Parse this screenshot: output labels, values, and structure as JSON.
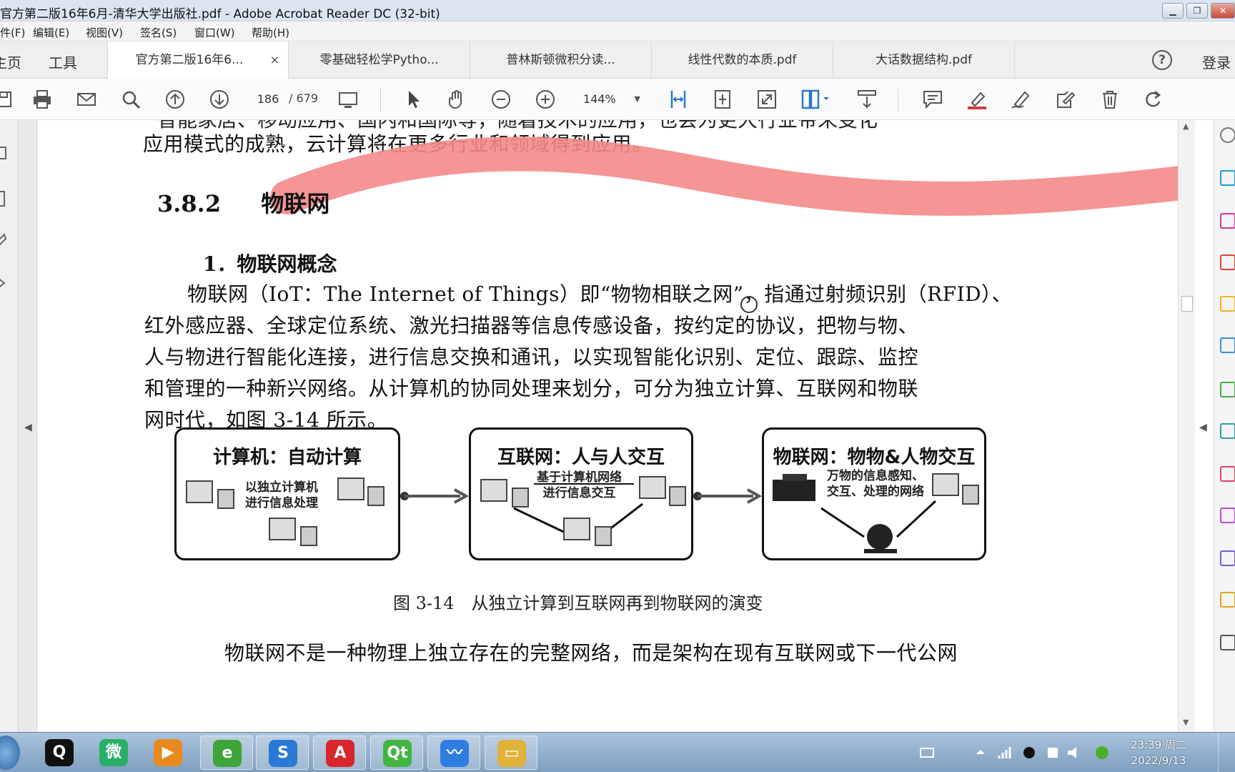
{
  "window": {
    "title": "官方第二版16年6月-清华大学出版社.pdf - Adobe Acrobat Reader DC (32-bit)"
  },
  "menu": [
    "件(F)",
    "编辑(E)",
    "视图(V)",
    "签名(S)",
    "窗口(W)",
    "帮助(H)"
  ],
  "nav": {
    "home": "主页",
    "tools": "工具",
    "login": "登录",
    "help_symbol": "?"
  },
  "tabs": [
    {
      "label": "官方第二版16年6...",
      "active": true,
      "close": "×"
    },
    {
      "label": "零基础轻松学Pytho...",
      "active": false
    },
    {
      "label": "普林斯顿微积分读...",
      "active": false
    },
    {
      "label": "线性代数的本质.pdf",
      "active": false
    },
    {
      "label": "大话数据结构.pdf",
      "active": false
    }
  ],
  "toolbar": {
    "page_current": "186",
    "page_total": "/ 679",
    "zoom": "144%",
    "icons": [
      "save-icon",
      "print-icon",
      "email-icon",
      "search-icon",
      "page-up-icon",
      "page-down-icon",
      "page-display-icon",
      "select-icon",
      "hand-icon",
      "zoom-out-icon",
      "zoom-in-icon",
      "fit-width-icon",
      "fit-page-icon",
      "full-screen-icon",
      "page-layout-icon",
      "scroll-mode-icon",
      "comment-icon",
      "highlight-icon",
      "sign-icon",
      "edit-icon",
      "delete-icon",
      "undo-icon"
    ],
    "highlight_color": "#d63a3a"
  },
  "document": {
    "cut_line": "智能家居、移动应用、国内和国际等，随着技术的应用，也会为更大行业带来变化",
    "line_0": "应用模式的成熟，云计算将在更多行业和领域得到应用。",
    "section_number": "3.8.2",
    "section_title": "物联网",
    "subsection": "1．物联网概念",
    "para_lines": [
      "物联网（IoT：The Internet of Things）即“物物相联之网”，指通过射频识别（RFID）、",
      "红外感应器、全球定位系统、激光扫描器等信息传感设备，按约定的协议，把物与物、",
      "人与物进行智能化连接，进行信息交换和通讯，以实现智能化识别、定位、跟踪、监控",
      "和管理的一种新兴网络。从计算机的协同处理来划分，可分为独立计算、互联网和物联",
      "网时代，如图 3-14 所示。"
    ],
    "highlight_stroke_color": "#f58a8a",
    "figure": {
      "boxes": [
        {
          "title": "计算机：自动计算",
          "text": [
            "以独立计算机",
            "进行信息处理"
          ]
        },
        {
          "title": "互联网：人与人交互",
          "text": [
            "基于计算机网络",
            "进行信息交互"
          ]
        },
        {
          "title": "物联网：物物&人物交互",
          "text": [
            "万物的信息感知、",
            "交互、处理的网络"
          ]
        }
      ],
      "caption": "图 3-14　从独立计算到互联网再到物联网的演变"
    },
    "bottom_line": "物联网不是一种物理上独立存在的完整网络，而是架构在现有互联网或下一代公网"
  },
  "taskbar": {
    "apps": [
      {
        "name": "qq",
        "glyph": "Q",
        "color": "#111111"
      },
      {
        "name": "wechat",
        "glyph": "微",
        "color": "#2aae67"
      },
      {
        "name": "media-player",
        "glyph": "▶",
        "color": "#e98a1e"
      },
      {
        "name": "browser",
        "glyph": "e",
        "color": "#3fa53a"
      },
      {
        "name": "sogou",
        "glyph": "S",
        "color": "#2a79d6"
      },
      {
        "name": "acrobat",
        "glyph": "A",
        "color": "#d9262b"
      },
      {
        "name": "qt",
        "glyph": "Qt",
        "color": "#41b541"
      },
      {
        "name": "feishu",
        "glyph": "〰",
        "color": "#2f7de0"
      },
      {
        "name": "explorer",
        "glyph": "▭",
        "color": "#e1b23a"
      }
    ],
    "clock_time": "23:39 周二",
    "clock_date": "2022/9/13"
  }
}
